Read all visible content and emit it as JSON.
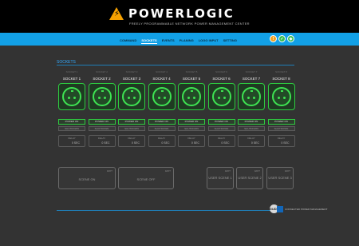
{
  "header": {
    "brand": "POWERLOGIC",
    "logo_glyph": "⚡",
    "tagline": "FREELY PROGRAMMABLE NETWORK POWER MANAGEMENT CENTER"
  },
  "nav": {
    "items": [
      "COMMAND",
      "SOCKETS",
      "EVENTS",
      "PLANING",
      "LOGG INPUT",
      "SETTING"
    ],
    "active": "SOCKETS"
  },
  "status_icons": [
    {
      "name": "warning-icon",
      "glyph": "!",
      "color": "#f0a020"
    },
    {
      "name": "ok-icon",
      "glyph": "✓",
      "color": "#38c050"
    },
    {
      "name": "cloud-icon",
      "glyph": "◆",
      "color": "#38c050"
    }
  ],
  "section": {
    "title": "SOCKETS"
  },
  "sockets": [
    {
      "status": "SOCKET 1",
      "name": "SOCKET 1",
      "on_label": "POWER ON",
      "off_label": "SHUTDOWN",
      "delay_label": "DELAY",
      "delay_value": "0 SEC"
    },
    {
      "status": "SOCKET 2",
      "name": "SOCKET 2",
      "on_label": "POWER ON",
      "off_label": "SHUTDOWN",
      "delay_label": "DELAY",
      "delay_value": "0 SEC"
    },
    {
      "status": "SOCKET 3",
      "name": "SOCKET 3",
      "on_label": "POWER ON",
      "off_label": "SHUTDOWN",
      "delay_label": "DELAY",
      "delay_value": "0 SEC"
    },
    {
      "status": "SOCKET 4",
      "name": "SOCKET 4",
      "on_label": "POWER ON",
      "off_label": "SHUTDOWN",
      "delay_label": "DELAY",
      "delay_value": "0 SEC"
    },
    {
      "status": "SOCKET 5",
      "name": "SOCKET 5",
      "on_label": "POWER ON",
      "off_label": "SHUTDOWN",
      "delay_label": "DELAY",
      "delay_value": "0 SEC"
    },
    {
      "status": "SOCKET 6",
      "name": "SOCKET 6",
      "on_label": "POWER ON",
      "off_label": "SHUTDOWN",
      "delay_label": "DELAY",
      "delay_value": "0 SEC"
    },
    {
      "status": "SOCKET 7",
      "name": "SOCKET 7",
      "on_label": "POWER ON",
      "off_label": "SHUTDOWN",
      "delay_label": "DELAY",
      "delay_value": "0 SEC"
    },
    {
      "status": "SOCKET 8",
      "name": "SOCKET 8",
      "on_label": "POWER ON",
      "off_label": "SHUTDOWN",
      "delay_label": "DELAY",
      "delay_value": "0 SEC"
    }
  ],
  "scenes": [
    {
      "label": "SCENE ON",
      "edit": "EDIT"
    },
    {
      "label": "SCENE OFF",
      "edit": "EDIT"
    },
    {
      "label": "USER SCENE 1",
      "edit": "EDIT"
    },
    {
      "label": "USER SCENE 2",
      "edit": "EDIT"
    },
    {
      "label": "USER SCENE 3",
      "edit": "EDIT"
    }
  ],
  "footer": {
    "logo_text": "GUDE",
    "logo_subtext": "CONNECTED POWER MANAGEMENT"
  },
  "colors": {
    "accent": "#12a0e6",
    "socket_on": "#2ecc40",
    "background": "#333333"
  }
}
